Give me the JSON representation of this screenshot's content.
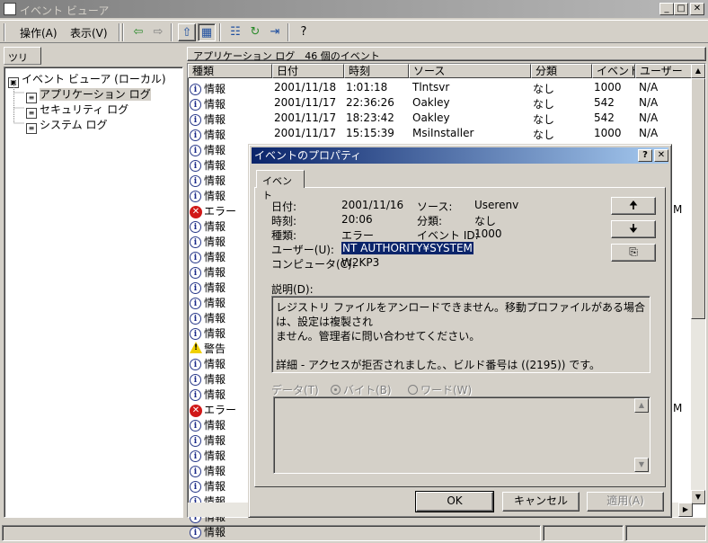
{
  "window": {
    "title": "イベント ビューア",
    "min": "_",
    "max": "□",
    "close": "✕"
  },
  "menu": {
    "action": "操作(A)",
    "view": "表示(V)"
  },
  "toolbar": {
    "back": "⇦",
    "forward": "⇨",
    "up": "⇧",
    "tree": "▦",
    "props": "☷",
    "refresh": "↻",
    "export": "⇥",
    "help": "?"
  },
  "tree": {
    "tab": "ツリー",
    "root": "イベント ビューア (ローカル)",
    "items": [
      "アプリケーション ログ",
      "セキュリティ ログ",
      "システム ログ"
    ]
  },
  "list": {
    "caption": "アプリケーション ログ　46 個のイベント",
    "columns": [
      "種類",
      "日付",
      "時刻",
      "ソース",
      "分類",
      "イベント",
      "ユーザー"
    ],
    "rows": [
      {
        "type": "info",
        "type_label": "情報",
        "date": "2001/11/18",
        "time": "1:01:18",
        "source": "Tlntsvr",
        "category": "なし",
        "event": "1000",
        "user": "N/A"
      },
      {
        "type": "info",
        "type_label": "情報",
        "date": "2001/11/17",
        "time": "22:36:26",
        "source": "Oakley",
        "category": "なし",
        "event": "542",
        "user": "N/A"
      },
      {
        "type": "info",
        "type_label": "情報",
        "date": "2001/11/17",
        "time": "18:23:42",
        "source": "Oakley",
        "category": "なし",
        "event": "542",
        "user": "N/A"
      },
      {
        "type": "info",
        "type_label": "情報",
        "date": "2001/11/17",
        "time": "15:15:39",
        "source": "MsiInstaller",
        "category": "なし",
        "event": "1000",
        "user": "N/A"
      },
      {
        "type": "info",
        "type_label": "情報"
      },
      {
        "type": "info",
        "type_label": "情報"
      },
      {
        "type": "info",
        "type_label": "情報"
      },
      {
        "type": "info",
        "type_label": "情報"
      },
      {
        "type": "error",
        "type_label": "エラー",
        "user": "M"
      },
      {
        "type": "info",
        "type_label": "情報"
      },
      {
        "type": "info",
        "type_label": "情報"
      },
      {
        "type": "info",
        "type_label": "情報"
      },
      {
        "type": "info",
        "type_label": "情報"
      },
      {
        "type": "info",
        "type_label": "情報"
      },
      {
        "type": "info",
        "type_label": "情報"
      },
      {
        "type": "info",
        "type_label": "情報"
      },
      {
        "type": "info",
        "type_label": "情報"
      },
      {
        "type": "warning",
        "type_label": "警告"
      },
      {
        "type": "info",
        "type_label": "情報"
      },
      {
        "type": "info",
        "type_label": "情報"
      },
      {
        "type": "info",
        "type_label": "情報"
      },
      {
        "type": "error",
        "type_label": "エラー",
        "user": "M"
      },
      {
        "type": "info",
        "type_label": "情報"
      },
      {
        "type": "info",
        "type_label": "情報"
      },
      {
        "type": "info",
        "type_label": "情報"
      },
      {
        "type": "info",
        "type_label": "情報"
      },
      {
        "type": "info",
        "type_label": "情報"
      },
      {
        "type": "info",
        "type_label": "情報"
      },
      {
        "type": "info",
        "type_label": "情報"
      },
      {
        "type": "info",
        "type_label": "情報"
      }
    ]
  },
  "dialog": {
    "title": "イベントのプロパティ",
    "help_btn": "?",
    "close_btn": "✕",
    "tab": "イベント",
    "labels": {
      "date": "日付:",
      "time": "時刻:",
      "type": "種類:",
      "user": "ユーザー(U):",
      "computer": "コンピュータ(C):",
      "source": "ソース:",
      "category": "分類:",
      "event_id": "イベント ID:",
      "description": "説明(D):",
      "data": "データ(T)",
      "bytes": "バイト(B)",
      "words": "ワード(W)"
    },
    "values": {
      "date": "2001/11/16",
      "time": "20:06",
      "type": "エラー",
      "user": "NT AUTHORITY¥SYSTEM",
      "computer": "W2KP3",
      "source": "Userenv",
      "category": "なし",
      "event_id": "1000"
    },
    "description_lines": [
      "レジストリ ファイルをアンロードできません。移動プロファイルがある場合は、設定は複製され",
      "ません。管理者に問い合わせてください。",
      "",
      "詳細 - アクセスが拒否されました。、ビルド番号は ((2195)) です。"
    ],
    "nav": {
      "up": "🠉",
      "down": "🠋",
      "copy": "⎘"
    },
    "buttons": {
      "ok": "OK",
      "cancel": "キャンセル",
      "apply": "適用(A)"
    }
  },
  "colors": {
    "face": "#d4d0c8",
    "titlebar_active": "#0a246a",
    "titlebar_inactive": "#808080",
    "error": "#d01818",
    "warning": "#f0d000"
  }
}
